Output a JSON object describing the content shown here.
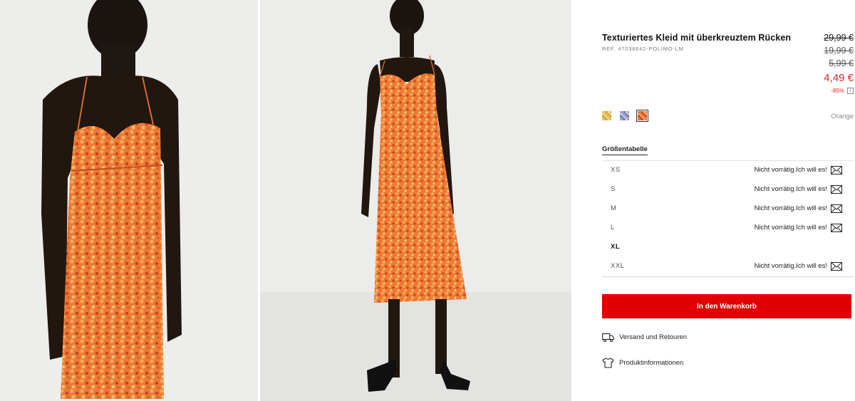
{
  "product": {
    "title": "Texturiertes Kleid mit überkreuztem Rücken",
    "ref": "REF. 47038642-POLIMO-LM",
    "prices": {
      "original_1": "29,99 €",
      "original_2": "19,99 €",
      "original_3": "5,99 €",
      "current": "4,49 €",
      "discount": "-85%"
    },
    "colors": [
      {
        "name": "yellow-pattern",
        "selected": false
      },
      {
        "name": "blue-pattern",
        "selected": false
      },
      {
        "name": "orange-pattern",
        "selected": true
      }
    ],
    "selected_color": "Orange",
    "accent_color": "#e00000"
  },
  "sizes": {
    "guide_label": "Größentabelle",
    "items": [
      {
        "label": "XS",
        "status": "Nicht vorrätig.Ich will es!",
        "available": false
      },
      {
        "label": "S",
        "status": "Nicht vorrätig.Ich will es!",
        "available": false
      },
      {
        "label": "M",
        "status": "Nicht vorrätig.Ich will es!",
        "available": false
      },
      {
        "label": "L",
        "status": "Nicht vorrätig.Ich will es!",
        "available": false
      },
      {
        "label": "XL",
        "status": "",
        "available": true
      },
      {
        "label": "XXL",
        "status": "Nicht vorrätig.Ich will es!",
        "available": false
      }
    ]
  },
  "actions": {
    "add_to_cart": "In den Warenkorb",
    "shipping": "Versand und Retouren",
    "product_info": "Produktinformationen"
  },
  "icons": {
    "notify": "envelope-icon",
    "shipping": "truck-icon",
    "product_info": "shirt-icon",
    "discount_info": "info-icon"
  }
}
